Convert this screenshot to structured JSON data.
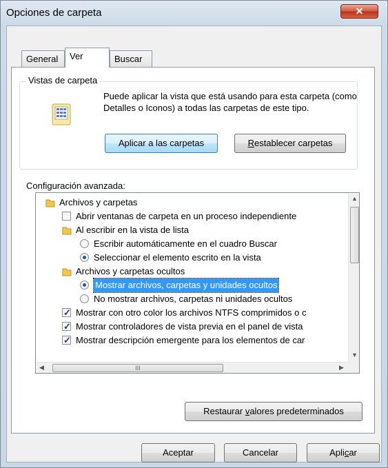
{
  "window": {
    "title": "Opciones de carpeta",
    "close_glyph": "✕"
  },
  "tabs": [
    {
      "label": "General"
    },
    {
      "label": "Ver"
    },
    {
      "label": "Buscar"
    }
  ],
  "folder_views": {
    "legend": "Vistas de carpeta",
    "description": "Puede aplicar la vista que está usando para esta carpeta (como Detalles o Iconos) a todas las carpetas de este tipo.",
    "apply_label": "Aplicar a las carpetas",
    "reset_label_prefix": "R",
    "reset_label_rest": "establecer carpetas"
  },
  "advanced": {
    "label": "Configuración avanzada:",
    "items": [
      {
        "text": "Archivos y carpetas",
        "type": "folder",
        "level": 0
      },
      {
        "text": "Abrir ventanas de carpeta  en un proceso independiente",
        "type": "checkbox",
        "checked": false,
        "level": 1
      },
      {
        "text": "Al escribir en la vista de lista",
        "type": "folder",
        "level": 1
      },
      {
        "text": "Escribir automáticamente en el cuadro Buscar",
        "type": "radio",
        "checked": false,
        "level": 2
      },
      {
        "text": "Seleccionar el elemento escrito en la vista",
        "type": "radio",
        "checked": true,
        "level": 2
      },
      {
        "text": "Archivos y carpetas ocultos",
        "type": "folder",
        "level": 1
      },
      {
        "text": "Mostrar archivos, carpetas y unidades ocultos",
        "type": "radio",
        "checked": true,
        "level": 2,
        "selected": true
      },
      {
        "text": "No mostrar archivos, carpetas ni unidades ocultos",
        "type": "radio",
        "checked": false,
        "level": 2
      },
      {
        "text": "Mostrar con otro color los archivos NTFS comprimidos o c",
        "type": "checkbox",
        "checked": true,
        "level": 1
      },
      {
        "text": "Mostrar controladores de vista previa en el panel de vista",
        "type": "checkbox",
        "checked": true,
        "level": 1
      },
      {
        "text": "Mostrar descripción emergente para los elementos de car",
        "type": "checkbox",
        "checked": true,
        "level": 1
      }
    ],
    "hscroll_grip": "III"
  },
  "restore_label_prefix": "Restaurar ",
  "restore_label_u": "v",
  "restore_label_rest": "alores predeterminados",
  "footer": {
    "ok": "Aceptar",
    "cancel": "Cancelar",
    "apply_prefix": "Apli",
    "apply_u": "c",
    "apply_rest": "ar"
  },
  "colors": {
    "accent": "#3399ff",
    "close": "#c94e36"
  }
}
